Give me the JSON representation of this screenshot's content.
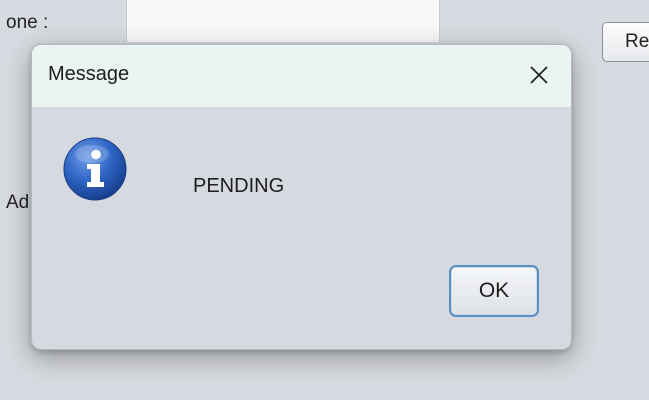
{
  "background": {
    "phone_label": "one :",
    "address_label": "Ad",
    "right_button_label": "Re"
  },
  "dialog": {
    "title": "Message",
    "message": "PENDING",
    "ok_label": "OK",
    "icon": "info-icon",
    "close_icon": "close-icon"
  }
}
